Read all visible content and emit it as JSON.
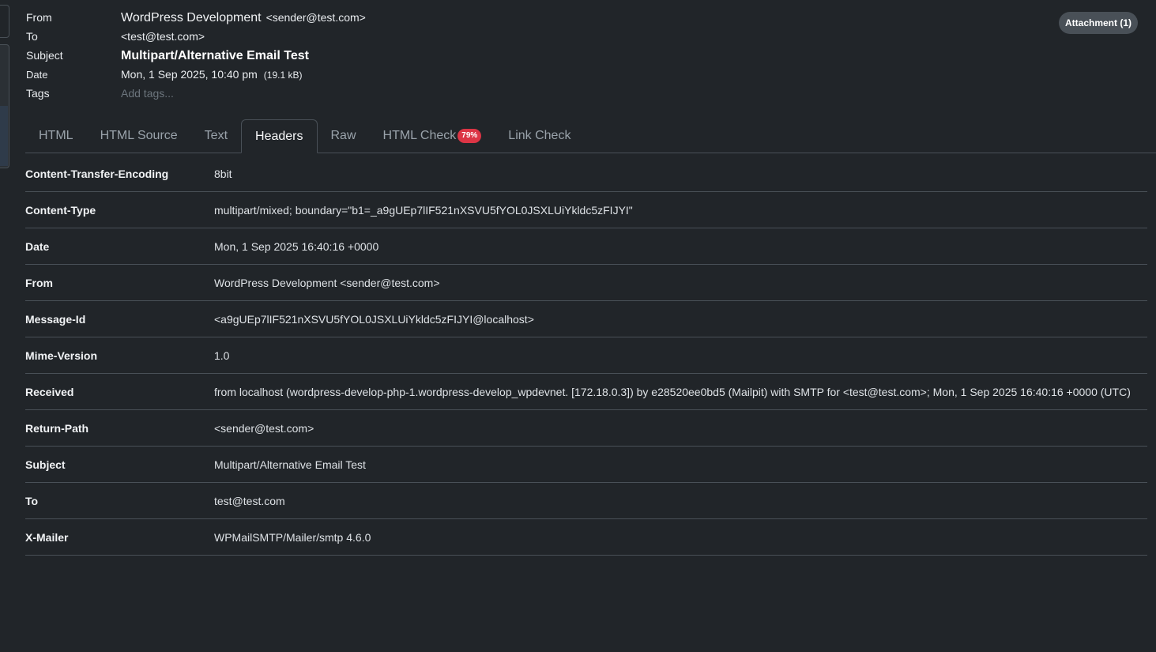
{
  "meta": {
    "from_label": "From",
    "from_name": "WordPress Development",
    "from_email": "<sender@test.com>",
    "to_label": "To",
    "to_value": "<test@test.com>",
    "subject_label": "Subject",
    "subject_value": "Multipart/Alternative Email Test",
    "date_label": "Date",
    "date_value": "Mon, 1 Sep 2025, 10:40 pm",
    "size_value": "(19.1 kB)",
    "tags_label": "Tags",
    "tags_placeholder": "Add tags..."
  },
  "attachment_button": "Attachment (1)",
  "tabs": [
    {
      "label": "HTML"
    },
    {
      "label": "HTML Source"
    },
    {
      "label": "Text"
    },
    {
      "label": "Headers",
      "active": true
    },
    {
      "label": "Raw"
    },
    {
      "label": "HTML Check",
      "badge": "79%"
    },
    {
      "label": "Link Check"
    }
  ],
  "headers": [
    {
      "name": "Content-Transfer-Encoding",
      "value": "8bit"
    },
    {
      "name": "Content-Type",
      "value": "multipart/mixed; boundary=\"b1=_a9gUEp7lIF521nXSVU5fYOL0JSXLUiYkldc5zFIJYI\""
    },
    {
      "name": "Date",
      "value": "Mon, 1 Sep 2025 16:40:16 +0000"
    },
    {
      "name": "From",
      "value": "WordPress Development <sender@test.com>"
    },
    {
      "name": "Message-Id",
      "value": "<a9gUEp7lIF521nXSVU5fYOL0JSXLUiYkldc5zFIJYI@localhost>"
    },
    {
      "name": "Mime-Version",
      "value": "1.0"
    },
    {
      "name": "Received",
      "value": "from localhost (wordpress-develop-php-1.wordpress-develop_wpdevnet. [172.18.0.3]) by e28520ee0bd5 (Mailpit) with SMTP for <test@test.com>; Mon, 1 Sep 2025 16:40:16 +0000 (UTC)"
    },
    {
      "name": "Return-Path",
      "value": "<sender@test.com>"
    },
    {
      "name": "Subject",
      "value": "Multipart/Alternative Email Test"
    },
    {
      "name": "To",
      "value": "test@test.com"
    },
    {
      "name": "X-Mailer",
      "value": "WPMailSMTP/Mailer/smtp 4.6.0"
    }
  ],
  "colors": {
    "background": "#212529",
    "border": "#495057",
    "badge": "#dc3545",
    "attachment_button": "#495057"
  }
}
